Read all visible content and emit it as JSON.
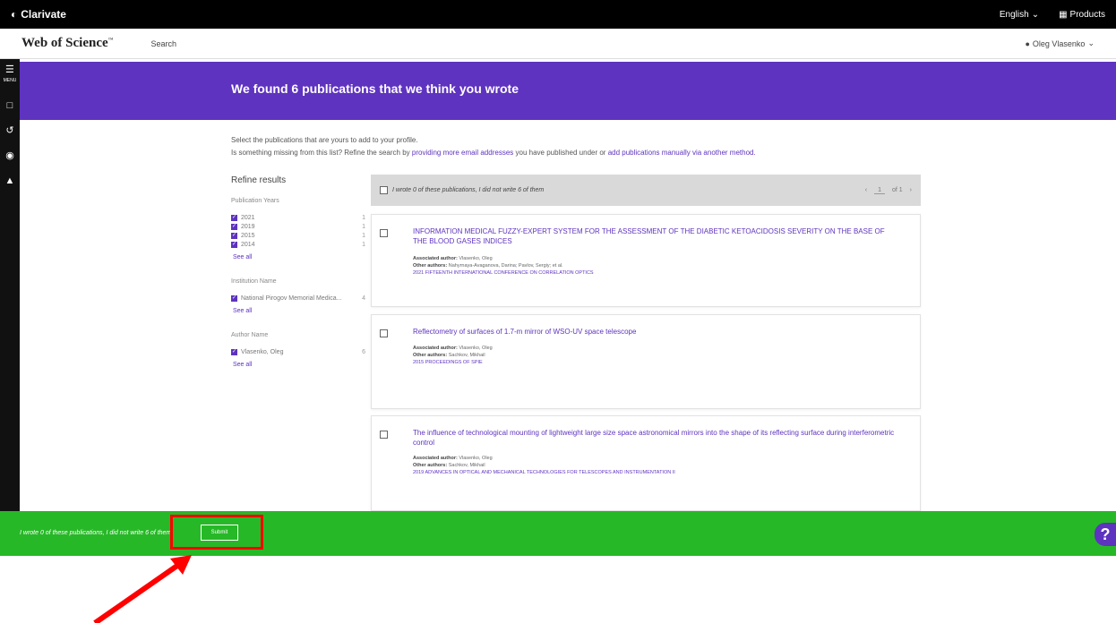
{
  "topbar": {
    "brand": "Clarivate",
    "language": "English",
    "products": "Products"
  },
  "header": {
    "logo": "Web of Science",
    "search": "Search",
    "user": "Oleg Vlasenko"
  },
  "rail": {
    "menu_label": "MENU"
  },
  "banner": {
    "title": "We found 6 publications that we think you wrote"
  },
  "intro": {
    "line1": "Select the publications that are yours to add to your profile.",
    "line2_prefix": "Is something missing from this list? Refine the search by",
    "link1": "providing more email addresses",
    "line2_mid": "you have published under or",
    "link2": "add publications manually via another method."
  },
  "refine": {
    "title": "Refine results",
    "pub_years_label": "Publication Years",
    "pub_years": [
      {
        "label": "2021",
        "count": "1"
      },
      {
        "label": "2019",
        "count": "1"
      },
      {
        "label": "2015",
        "count": "1"
      },
      {
        "label": "2014",
        "count": "1"
      }
    ],
    "see_all": "See all",
    "institution_label": "Institution Name",
    "institutions": [
      {
        "label": "National Pirogov Memorial Medica...",
        "count": "4"
      }
    ],
    "author_label": "Author Name",
    "authors": [
      {
        "label": "Vlasenko, Oleg",
        "count": "6"
      }
    ]
  },
  "toolbar": {
    "select_text": "I wrote 0 of these publications, I did not write 6 of them",
    "page": "1",
    "of": "of 1"
  },
  "results": [
    {
      "title": "INFORMATION MEDICAL FUZZY-EXPERT SYSTEM FOR THE ASSESSMENT OF THE DIABETIC KETOACIDOSIS SEVERITY ON THE BASE OF THE BLOOD GASES INDICES",
      "associated": "Vlasenko, Oleg",
      "others": "Nahyrnaya-Avaganova, Darina; Pavlov, Sergiy; et al.",
      "source": "2021 FIFTEENTH INTERNATIONAL CONFERENCE ON CORRELATION OPTICS"
    },
    {
      "title": "Reflectometry of surfaces of 1.7-m mirror of WSO-UV space telescope",
      "associated": "Vlasenko, Oleg",
      "others": "Sachkov, Mikhail",
      "source": "2015 PROCEEDINGS OF SPIE"
    },
    {
      "title": "The influence of technological mounting of lightweight large size space astronomical mirrors into the shape of its reflecting surface during interferometric control",
      "associated": "Vlasenko, Oleg",
      "others": "Sachkov, Mikhail",
      "source": "2019 ADVANCES IN OPTICAL AND MECHANICAL TECHNOLOGIES FOR TELESCOPES AND INSTRUMENTATION II"
    }
  ],
  "meta_labels": {
    "associated": "Associated author:",
    "others": "Other authors:"
  },
  "footer": {
    "message": "I wrote 0 of these publications, I did not write 6 of them",
    "submit": "Submit",
    "help": "?"
  },
  "colors": {
    "accent": "#5e33bf",
    "footer_green": "#27b827",
    "annotation_red": "#ff0000"
  }
}
